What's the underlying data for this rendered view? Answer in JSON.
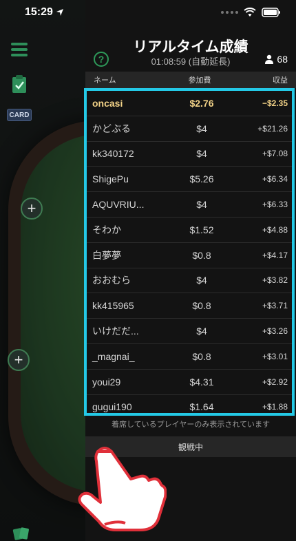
{
  "status_bar": {
    "time": "15:29"
  },
  "left_rail": {
    "card_label": "CARD"
  },
  "panel": {
    "title": "リアルタイム成績",
    "subtitle": "01:08:59 (自動延長)",
    "player_count": "68",
    "columns": {
      "name": "ネーム",
      "fee": "参加費",
      "profit": "収益"
    },
    "rows": [
      {
        "name": "oncasi",
        "fee": "$2.76",
        "profit": "−$2.35",
        "highlight": true
      },
      {
        "name": "かどぶる",
        "fee": "$4",
        "profit": "+$21.26"
      },
      {
        "name": "kk340172",
        "fee": "$4",
        "profit": "+$7.08"
      },
      {
        "name": "ShigePu",
        "fee": "$5.26",
        "profit": "+$6.34"
      },
      {
        "name": "AQUVRIU...",
        "fee": "$4",
        "profit": "+$6.33"
      },
      {
        "name": "そわか",
        "fee": "$1.52",
        "profit": "+$4.88"
      },
      {
        "name": "白夢夢",
        "fee": "$0.8",
        "profit": "+$4.17"
      },
      {
        "name": "おおむら",
        "fee": "$4",
        "profit": "+$3.82"
      },
      {
        "name": "kk415965",
        "fee": "$0.8",
        "profit": "+$3.71"
      },
      {
        "name": "いけだだ...",
        "fee": "$4",
        "profit": "+$3.26"
      },
      {
        "name": "_magnai_",
        "fee": "$0.8",
        "profit": "+$3.01"
      },
      {
        "name": "youi29",
        "fee": "$4.31",
        "profit": "+$2.92"
      },
      {
        "name": "gugui190",
        "fee": "$1.64",
        "profit": "+$1.88"
      }
    ],
    "note": "着席しているプレイヤーのみ表示されています",
    "spectating_label": "観戦中"
  },
  "colors": {
    "accent": "#24c9e6",
    "highlight_text": "#f2d287",
    "green": "#2e9a5a"
  }
}
